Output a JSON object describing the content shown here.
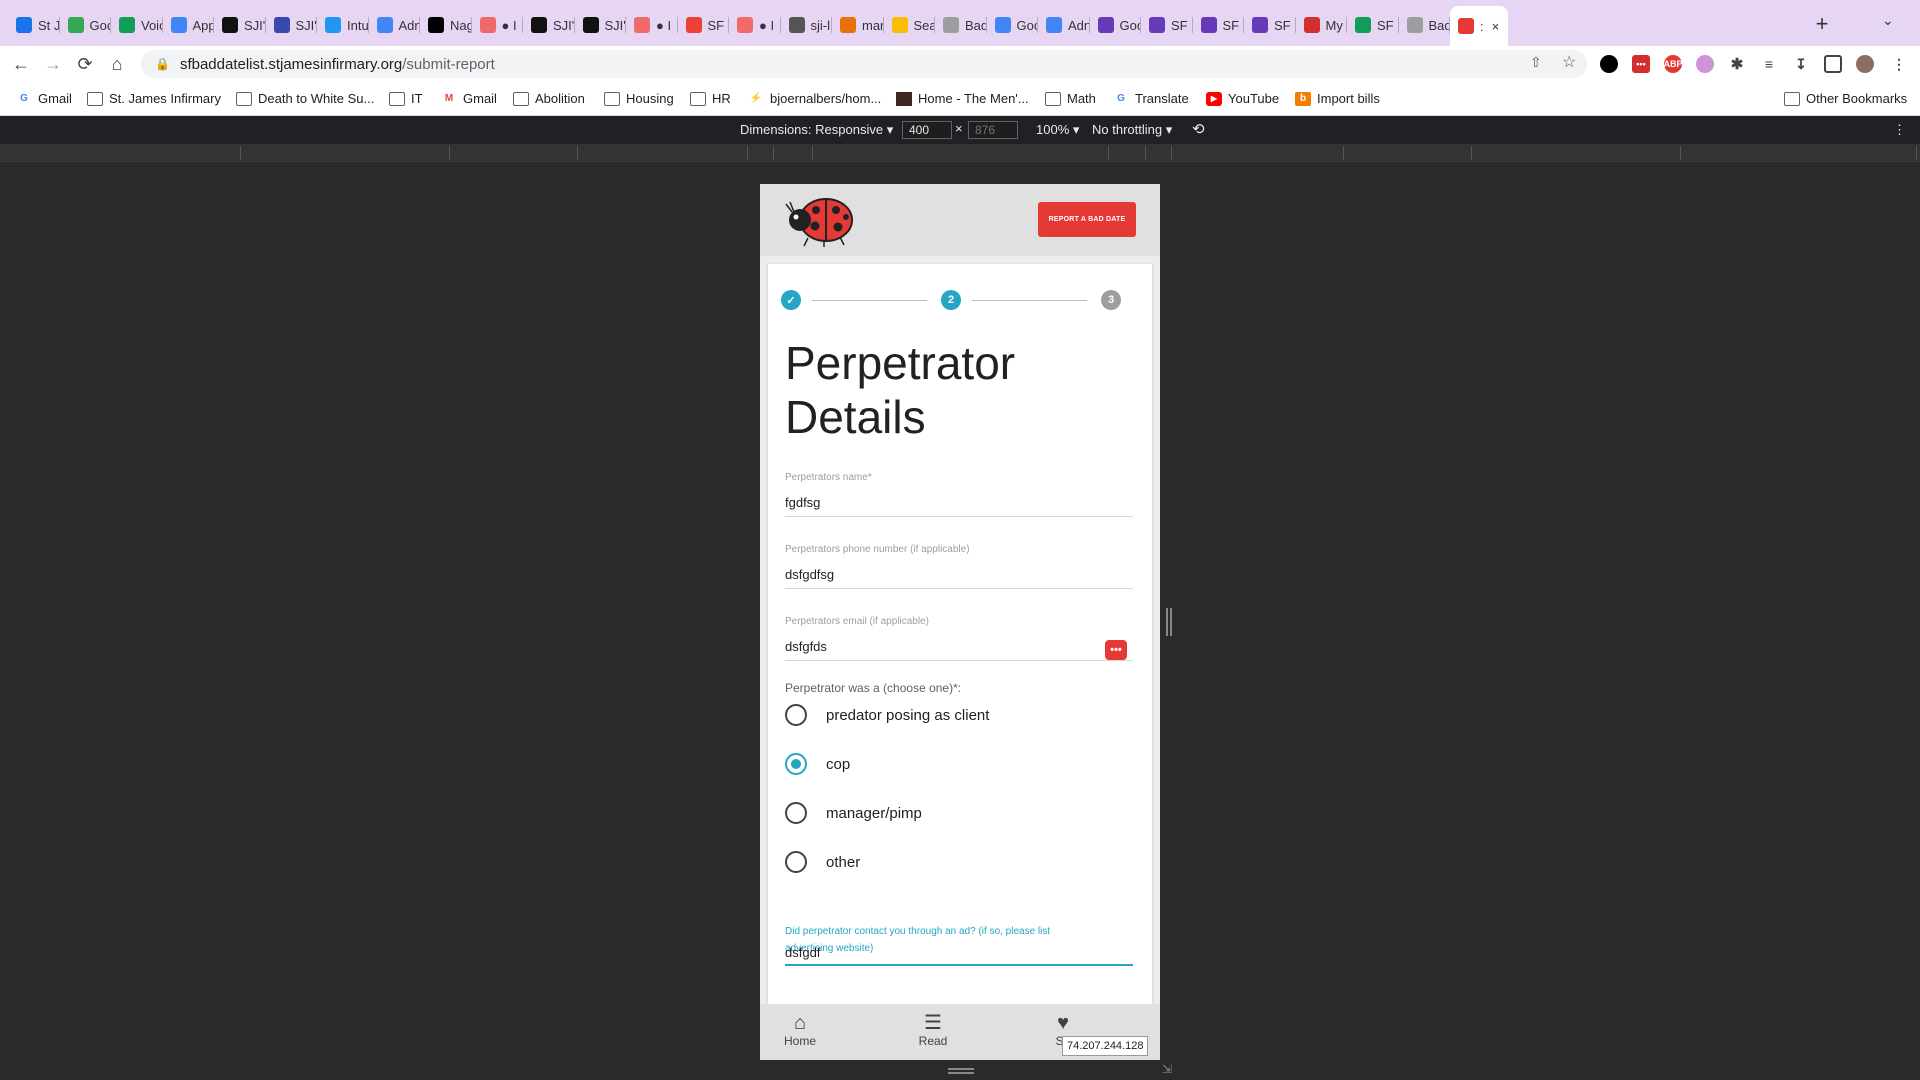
{
  "browser": {
    "tabs": [
      {
        "label": "St J",
        "icon": "calendar-icon",
        "color": "#1a73e8"
      },
      {
        "label": "Goo",
        "icon": "google-icon",
        "color": "#34a853"
      },
      {
        "label": "Voic",
        "icon": "phone-icon",
        "color": "#0f9d58"
      },
      {
        "label": "App",
        "icon": "app-icon",
        "color": "#4285f4"
      },
      {
        "label": "SJI'",
        "icon": "ladybug-icon",
        "color": "#111111"
      },
      {
        "label": "SJI'",
        "icon": "form-icon",
        "color": "#3949ab"
      },
      {
        "label": "Intu",
        "icon": "intuit-icon",
        "color": "#2196f3"
      },
      {
        "label": "Adn",
        "icon": "admin-icon",
        "color": "#4285f4"
      },
      {
        "label": "Nag",
        "icon": "notion-icon",
        "color": "#000000"
      },
      {
        "label": "● I",
        "icon": "asana-icon",
        "color": "#f06a6a"
      },
      {
        "label": "SJI'",
        "icon": "ladybug-icon",
        "color": "#111111"
      },
      {
        "label": "SJI'",
        "icon": "ladybug-icon",
        "color": "#111111"
      },
      {
        "label": "● I",
        "icon": "asana-icon",
        "color": "#f06a6a"
      },
      {
        "label": "SF I",
        "icon": "gmail-icon",
        "color": "#ea4335"
      },
      {
        "label": "● I",
        "icon": "asana-icon",
        "color": "#f06a6a"
      },
      {
        "label": "sji-l",
        "icon": "github-icon",
        "color": "#555555"
      },
      {
        "label": "mar",
        "icon": "draw-icon",
        "color": "#e8710a"
      },
      {
        "label": "Sea",
        "icon": "drive-icon",
        "color": "#fbbc04"
      },
      {
        "label": "Bad",
        "icon": "globe-icon",
        "color": "#9e9e9e"
      },
      {
        "label": "Goo",
        "icon": "google-icon",
        "color": "#4285f4"
      },
      {
        "label": "Adn",
        "icon": "admin-icon",
        "color": "#4285f4"
      },
      {
        "label": "Goo",
        "icon": "form-icon",
        "color": "#673ab7"
      },
      {
        "label": "SF I",
        "icon": "form-icon",
        "color": "#673ab7"
      },
      {
        "label": "SF I",
        "icon": "form-icon",
        "color": "#673ab7"
      },
      {
        "label": "SF I",
        "icon": "form-icon",
        "color": "#673ab7"
      },
      {
        "label": "My",
        "icon": "lastpass-icon",
        "color": "#d32f2f"
      },
      {
        "label": "SF I",
        "icon": "sheets-icon",
        "color": "#0f9d58"
      },
      {
        "label": "Bad",
        "icon": "globe-icon",
        "color": "#9e9e9e"
      },
      {
        "label": ":",
        "icon": "ladybug-icon",
        "color": "#e53935",
        "active": true
      }
    ],
    "url_host": "sfbaddatelist.stjamesinfirmary.org",
    "url_path": "/submit-report",
    "bookmarks": [
      {
        "label": "Gmail",
        "icon": "google-icon"
      },
      {
        "label": "St. James Infirmary",
        "icon": "folder-icon"
      },
      {
        "label": "Death to White Su...",
        "icon": "folder-icon"
      },
      {
        "label": "IT",
        "icon": "folder-icon"
      },
      {
        "label": "Gmail",
        "icon": "gmail-icon"
      },
      {
        "label": "Abolition",
        "icon": "folder-icon"
      },
      {
        "label": "Housing",
        "icon": "folder-icon"
      },
      {
        "label": "HR",
        "icon": "folder-icon"
      },
      {
        "label": "bjoernalbers/hom...",
        "icon": "lightning-icon"
      },
      {
        "label": "Home - The Men'...",
        "icon": "site-icon"
      },
      {
        "label": "Math",
        "icon": "folder-icon"
      },
      {
        "label": "Translate",
        "icon": "translate-icon"
      },
      {
        "label": "YouTube",
        "icon": "youtube-icon"
      },
      {
        "label": "Import bills",
        "icon": "b-icon"
      }
    ],
    "other_bookmarks": "Other Bookmarks"
  },
  "devtools": {
    "dimensions_label": "Dimensions: Responsive",
    "width": "400",
    "height_placeholder": "876",
    "times": "×",
    "zoom": "100%",
    "throttling": "No throttling"
  },
  "app": {
    "report_button": "REPORT A BAD DATE",
    "steps": [
      {
        "label": "",
        "state": "done"
      },
      {
        "label": "2",
        "state": "active"
      },
      {
        "label": "3",
        "state": "pending"
      }
    ],
    "title": "Perpetrator Details",
    "fields": [
      {
        "label": "Perpetrators name*",
        "value": "fgdfsg"
      },
      {
        "label": "Perpetrators phone number (if applicable)",
        "value": "dsfgdfsg"
      },
      {
        "label": "Perpetrators email (if applicable)",
        "value": "dsfgfds"
      }
    ],
    "radio_question": "Perpetrator was a (choose one)*:",
    "radio_options": [
      {
        "label": "predator posing as client",
        "selected": false
      },
      {
        "label": "cop",
        "selected": true
      },
      {
        "label": "manager/pimp",
        "selected": false
      },
      {
        "label": "other",
        "selected": false
      }
    ],
    "ad_question": "Did perpetrator contact you through an ad? (if so, please list advertising website)",
    "ad_value": "dsfgdf",
    "nav": [
      {
        "label": "Home",
        "icon": "home-icon"
      },
      {
        "label": "Read",
        "icon": "list-icon"
      },
      {
        "label": "Su",
        "icon": "heart-icon"
      }
    ],
    "ip_tooltip": "74.207.244.128"
  },
  "colors": {
    "accent": "#26a5c5",
    "brand_red": "#e53935",
    "step_pending": "#9e9e9e"
  }
}
